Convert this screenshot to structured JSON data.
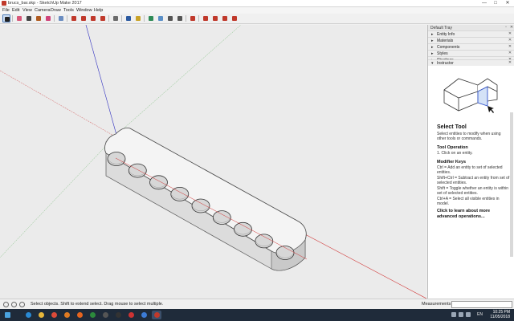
{
  "window": {
    "title": "brucs_bar.skp - SketchUp Make 2017",
    "minimize": "—",
    "maximize": "□",
    "close": "✕"
  },
  "menu": [
    "File",
    "Edit",
    "View",
    "Camera",
    "Draw",
    "Tools",
    "Window",
    "Help"
  ],
  "toolbar": {
    "tools": [
      {
        "name": "select-tool",
        "color": "#222222",
        "selected": true
      },
      {
        "name": "eraser-tool",
        "color": "#d8587a"
      },
      {
        "name": "line-tool",
        "color": "#444444"
      },
      {
        "name": "arc-tool",
        "color": "#b05b20"
      },
      {
        "name": "shape-tool",
        "color": "#d0447a"
      },
      {
        "name": "pushpull-tool",
        "color": "#6a8cc0"
      },
      {
        "name": "offset-tool",
        "color": "#c0392b"
      },
      {
        "name": "move-tool",
        "color": "#c0392b"
      },
      {
        "name": "rotate-tool",
        "color": "#c0392b"
      },
      {
        "name": "scale-tool",
        "color": "#c0392b"
      },
      {
        "name": "tape-measure-tool",
        "color": "#6b6b6b"
      },
      {
        "name": "text-tool",
        "color": "#2c5aa0"
      },
      {
        "name": "paint-bucket-tool",
        "color": "#c9a227"
      },
      {
        "name": "orbit-tool",
        "color": "#2e8b57"
      },
      {
        "name": "pan-tool",
        "color": "#5a8fc7"
      },
      {
        "name": "zoom-tool",
        "color": "#555555"
      },
      {
        "name": "zoom-window-tool",
        "color": "#555555"
      },
      {
        "name": "zoom-extents-tool",
        "color": "#c0392b"
      },
      {
        "name": "warehouse-tool",
        "color": "#c0392b"
      },
      {
        "name": "extension-warehouse-tool",
        "color": "#c0392b"
      },
      {
        "name": "share-model-tool",
        "color": "#c0392b"
      },
      {
        "name": "layout-tool",
        "color": "#c0392b"
      }
    ]
  },
  "tray": {
    "title": "Default Tray",
    "pin": "▫",
    "close": "✕",
    "panels": [
      {
        "label": "Entity Info",
        "caret": "▸"
      },
      {
        "label": "Materials",
        "caret": "▸"
      },
      {
        "label": "Components",
        "caret": "▸"
      },
      {
        "label": "Styles",
        "caret": "▸"
      },
      {
        "label": "Shadows",
        "caret": "▸"
      },
      {
        "label": "Instructor",
        "caret": "▾"
      }
    ],
    "panel_close": "✕",
    "instructor": {
      "tool_title": "Select Tool",
      "tool_desc": "Select entities to modify when using other tools or commands.",
      "operation_heading": "Tool Operation",
      "operation_text": "1. Click on an entity.",
      "modifier_heading": "Modifier Keys",
      "modifier_text_1": "Ctrl = Add an entity to set of selected entities.",
      "modifier_text_2": "Shift+Ctrl = Subtract an entity from set of selected entities.",
      "modifier_text_3": "Shift = Toggle whether an entity is within set of selected entities.",
      "modifier_text_4": "Ctrl+A = Select all visible entities in model.",
      "learn_more": "Click to learn about more advanced operations..."
    }
  },
  "statusbar": {
    "hint": "Select objects. Shift to extend select. Drag mouse to select multiple.",
    "measurements_label": "Measurements",
    "measurements_value": ""
  },
  "taskbar": {
    "apps": [
      {
        "name": "start-button",
        "color": "#4aa3df"
      },
      {
        "name": "ie-app",
        "color": "#2a8ad4"
      },
      {
        "name": "explorer-app",
        "color": "#e8b73a"
      },
      {
        "name": "chrome-app",
        "color": "#dd4b39"
      },
      {
        "name": "media-app",
        "color": "#e07b22"
      },
      {
        "name": "firefox-app",
        "color": "#e5641f"
      },
      {
        "name": "app-6",
        "color": "#2c8a3c"
      },
      {
        "name": "app-7",
        "color": "#555555"
      },
      {
        "name": "app-8",
        "color": "#333333"
      },
      {
        "name": "app-9",
        "color": "#cc3333"
      },
      {
        "name": "app-10",
        "color": "#3c7bd5"
      },
      {
        "name": "sketchup-app",
        "color": "#c0392b",
        "active": true
      }
    ],
    "language": "EN",
    "time": "10:25 PM",
    "date": "11/05/2018"
  },
  "model": {
    "hole_count": 9
  }
}
